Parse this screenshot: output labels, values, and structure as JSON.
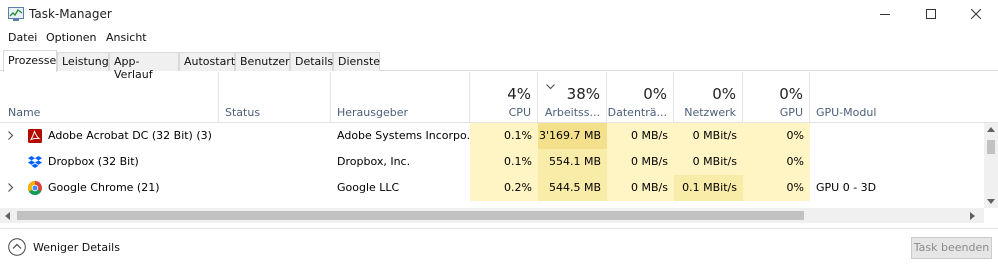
{
  "window": {
    "title": "Task-Manager"
  },
  "menu": [
    "Datei",
    "Optionen",
    "Ansicht"
  ],
  "tabs": [
    "Prozesse",
    "Leistung",
    "App-Verlauf",
    "Autostart",
    "Benutzer",
    "Details",
    "Dienste"
  ],
  "active_tab": "Prozesse",
  "columns": {
    "name": "Name",
    "status": "Status",
    "publisher": "Herausgeber",
    "cpu": {
      "label": "CPU",
      "pct": "4%"
    },
    "memory": {
      "label": "Arbeitss...",
      "pct": "38%"
    },
    "disk": {
      "label": "Datenträ...",
      "pct": "0%"
    },
    "network": {
      "label": "Netzwerk",
      "pct": "0%"
    },
    "gpu": {
      "label": "GPU",
      "pct": "0%"
    },
    "gpu_engine": "GPU-Modul"
  },
  "processes": [
    {
      "name": "Adobe Acrobat DC (32 Bit) (3)",
      "icon": "acrobat-icon",
      "expandable": true,
      "status": "",
      "publisher": "Adobe Systems Incorpo...",
      "cpu": "0.1%",
      "memory": "3'169.7 MB",
      "disk": "0 MB/s",
      "network": "0 MBit/s",
      "gpu": "0%",
      "gpu_engine": ""
    },
    {
      "name": "Dropbox (32 Bit)",
      "icon": "dropbox-icon",
      "expandable": false,
      "status": "",
      "publisher": "Dropbox, Inc.",
      "cpu": "0.1%",
      "memory": "554.1 MB",
      "disk": "0 MB/s",
      "network": "0 MBit/s",
      "gpu": "0%",
      "gpu_engine": ""
    },
    {
      "name": "Google Chrome (21)",
      "icon": "chrome-icon",
      "expandable": true,
      "status": "",
      "publisher": "Google LLC",
      "cpu": "0.2%",
      "memory": "544.5 MB",
      "disk": "0 MB/s",
      "network": "0.1 MBit/s",
      "gpu": "0%",
      "gpu_engine": "GPU 0 - 3D"
    }
  ],
  "footer": {
    "fewer_details": "Weniger Details",
    "end_task": "Task beenden"
  },
  "colors": {
    "heat_light": "#fff4c4",
    "heat_medium": "#f9eca8",
    "heat_strong": "#f4e08b",
    "header_text": "#4c607a"
  }
}
